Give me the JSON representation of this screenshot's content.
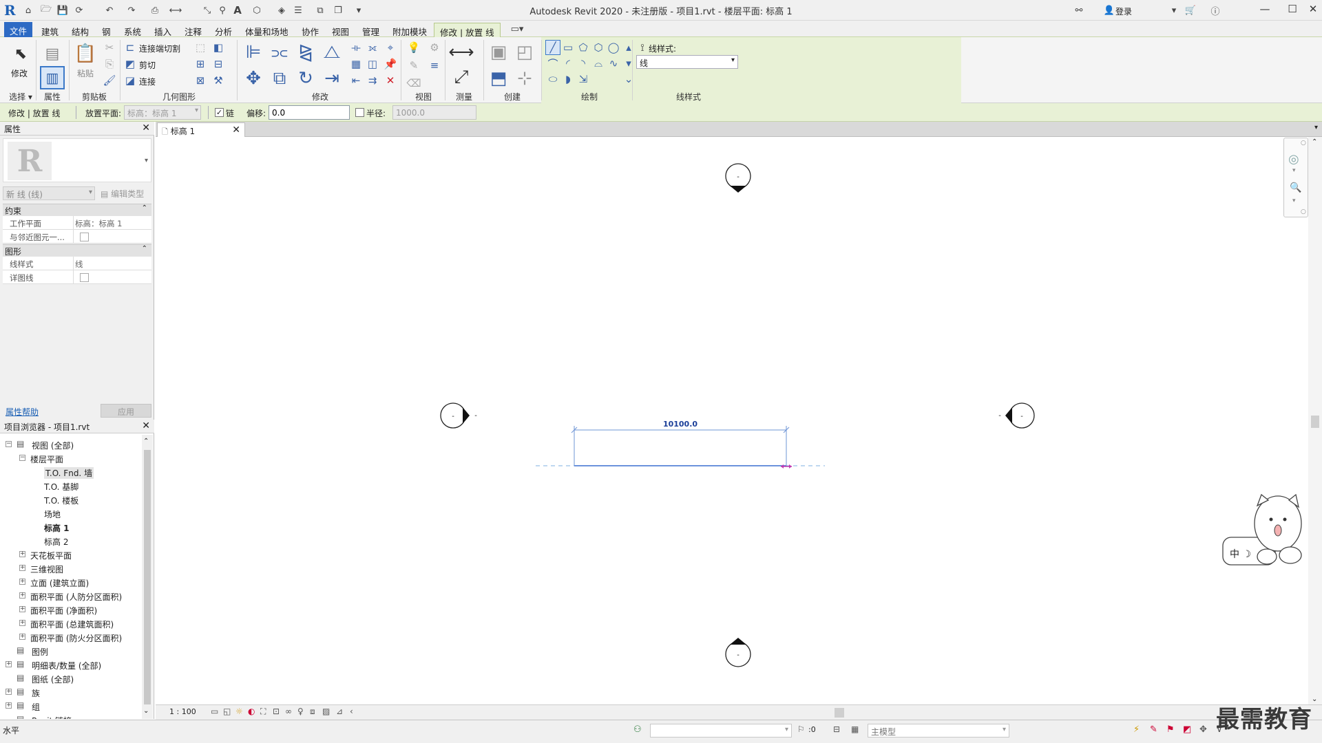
{
  "window": {
    "title": "Autodesk Revit 2020 - 未注册版 - 项目1.rvt - 楼层平面: 标高 1",
    "login": "登录"
  },
  "tabs": [
    "文件",
    "建筑",
    "结构",
    "钢",
    "系统",
    "插入",
    "注释",
    "分析",
    "体量和场地",
    "协作",
    "视图",
    "管理",
    "附加模块",
    "修改 | 放置 线"
  ],
  "ribbon": {
    "select_label": "选择 ▾",
    "properties_label": "属性",
    "clipboard_label": "剪贴板",
    "geometry_label": "几何图形",
    "modify_label": "修改",
    "view_label": "视图",
    "measure_label": "测量",
    "create_label": "创建",
    "draw_label": "绘制",
    "linestyle_panel_label": "线样式",
    "modify_btn": "修改",
    "paste_btn": "粘贴",
    "join_cut": "连接端切割",
    "cut": "剪切",
    "join": "连接",
    "linestyle_caption": "线样式:",
    "linestyle_value": "线"
  },
  "optbar": {
    "context": "修改 | 放置 线",
    "plane_label": "放置平面:",
    "plane_value": "标高：标高 1",
    "chain_label": "链",
    "offset_label": "偏移:",
    "offset_value": "0.0",
    "radius_label": "半径:",
    "radius_value": "1000.0"
  },
  "properties": {
    "title": "属性",
    "type_selector": "新 线 (线)",
    "edit_type": "编辑类型",
    "sections": [
      {
        "name": "约束",
        "rows": [
          {
            "k": "工作平面",
            "v": "标高：标高 1"
          },
          {
            "k": "与邻近图元一...",
            "v": ""
          }
        ]
      },
      {
        "name": "图形",
        "rows": [
          {
            "k": "线样式",
            "v": "线"
          },
          {
            "k": "详图线",
            "v": ""
          }
        ]
      }
    ],
    "help_link": "属性帮助",
    "apply": "应用"
  },
  "browser": {
    "title": "项目浏览器 - 项目1.rvt",
    "items": [
      {
        "label": "视图 (全部)",
        "level": 0,
        "toggle": "−"
      },
      {
        "label": "楼层平面",
        "level": 1,
        "toggle": "−"
      },
      {
        "label": "T.O. Fnd. 墙",
        "level": 2,
        "toggle": ""
      },
      {
        "label": "T.O. 基脚",
        "level": 2,
        "toggle": ""
      },
      {
        "label": "T.O. 楼板",
        "level": 2,
        "toggle": ""
      },
      {
        "label": "场地",
        "level": 2,
        "toggle": ""
      },
      {
        "label": "标高 1",
        "level": 2,
        "toggle": "",
        "bold": true
      },
      {
        "label": "标高 2",
        "level": 2,
        "toggle": ""
      },
      {
        "label": "天花板平面",
        "level": 1,
        "toggle": "+"
      },
      {
        "label": "三维视图",
        "level": 1,
        "toggle": "+"
      },
      {
        "label": "立面 (建筑立面)",
        "level": 1,
        "toggle": "+"
      },
      {
        "label": "面积平面 (人防分区面积)",
        "level": 1,
        "toggle": "+"
      },
      {
        "label": "面积平面 (净面积)",
        "level": 1,
        "toggle": "+"
      },
      {
        "label": "面积平面 (总建筑面积)",
        "level": 1,
        "toggle": "+"
      },
      {
        "label": "面积平面 (防火分区面积)",
        "level": 1,
        "toggle": "+"
      },
      {
        "label": "图例",
        "level": 0,
        "toggle": ""
      },
      {
        "label": "明细表/数量 (全部)",
        "level": 0,
        "toggle": "+"
      },
      {
        "label": "图纸 (全部)",
        "level": 0,
        "toggle": ""
      },
      {
        "label": "族",
        "level": 0,
        "toggle": "+"
      },
      {
        "label": "组",
        "level": 0,
        "toggle": "+"
      },
      {
        "label": "Revit 链接",
        "level": 0,
        "toggle": ""
      }
    ]
  },
  "view": {
    "tab_label": "标高 1",
    "dimension": "10100.0",
    "scale": "1 : 100"
  },
  "status": {
    "left": "水平",
    "selection_count": ":0",
    "model": "主模型"
  },
  "sticker": {
    "text": "中 ☽"
  },
  "watermark": "最需教育"
}
